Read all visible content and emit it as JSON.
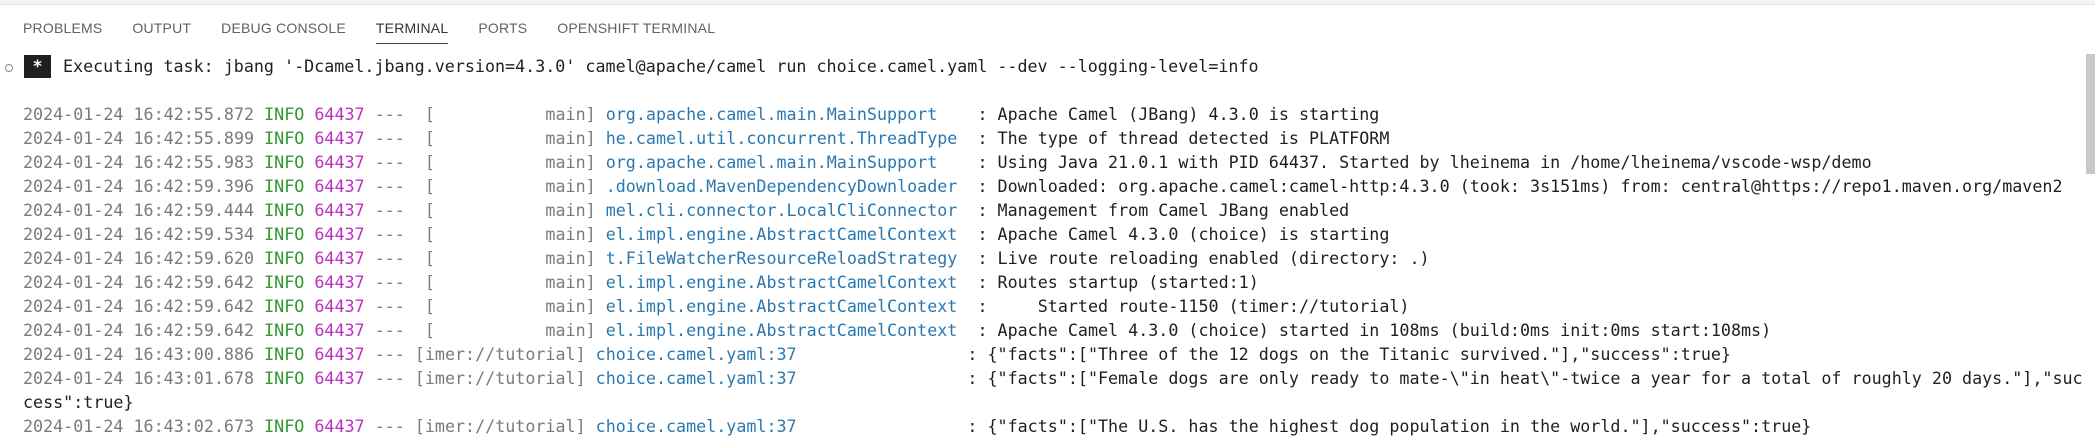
{
  "panel_tabs": [
    "PROBLEMS",
    "OUTPUT",
    "DEBUG CONSOLE",
    "TERMINAL",
    "PORTS",
    "OPENSHIFT TERMINAL"
  ],
  "active_tab": "TERMINAL",
  "task": {
    "badge": "*",
    "text": "Executing task: jbang '-Dcamel.jbang.version=4.3.0' camel@apache/camel run choice.camel.yaml --dev --logging-level=info"
  },
  "log_lines": [
    {
      "ts": "2024-01-24 16:42:55.872",
      "level": "INFO",
      "pid": "64437",
      "thread": "---  [           main]",
      "cls": "org.apache.camel.main.MainSupport   ",
      "msg": ": Apache Camel (JBang) 4.3.0 is starting"
    },
    {
      "ts": "2024-01-24 16:42:55.899",
      "level": "INFO",
      "pid": "64437",
      "thread": "---  [           main]",
      "cls": "he.camel.util.concurrent.ThreadType ",
      "msg": ": The type of thread detected is PLATFORM"
    },
    {
      "ts": "2024-01-24 16:42:55.983",
      "level": "INFO",
      "pid": "64437",
      "thread": "---  [           main]",
      "cls": "org.apache.camel.main.MainSupport   ",
      "msg": ": Using Java 21.0.1 with PID 64437. Started by lheinema in /home/lheinema/vscode-wsp/demo"
    },
    {
      "ts": "2024-01-24 16:42:59.396",
      "level": "INFO",
      "pid": "64437",
      "thread": "---  [           main]",
      "cls": ".download.MavenDependencyDownloader ",
      "msg": ": Downloaded: org.apache.camel:camel-http:4.3.0 (took: 3s151ms) from: central@https://repo1.maven.org/maven2"
    },
    {
      "ts": "2024-01-24 16:42:59.444",
      "level": "INFO",
      "pid": "64437",
      "thread": "---  [           main]",
      "cls": "mel.cli.connector.LocalCliConnector ",
      "msg": ": Management from Camel JBang enabled"
    },
    {
      "ts": "2024-01-24 16:42:59.534",
      "level": "INFO",
      "pid": "64437",
      "thread": "---  [           main]",
      "cls": "el.impl.engine.AbstractCamelContext ",
      "msg": ": Apache Camel 4.3.0 (choice) is starting"
    },
    {
      "ts": "2024-01-24 16:42:59.620",
      "level": "INFO",
      "pid": "64437",
      "thread": "---  [           main]",
      "cls": "t.FileWatcherResourceReloadStrategy ",
      "msg": ": Live route reloading enabled (directory: .)"
    },
    {
      "ts": "2024-01-24 16:42:59.642",
      "level": "INFO",
      "pid": "64437",
      "thread": "---  [           main]",
      "cls": "el.impl.engine.AbstractCamelContext ",
      "msg": ": Routes startup (started:1)"
    },
    {
      "ts": "2024-01-24 16:42:59.642",
      "level": "INFO",
      "pid": "64437",
      "thread": "---  [           main]",
      "cls": "el.impl.engine.AbstractCamelContext ",
      "msg": ":     Started route-1150 (timer://tutorial)"
    },
    {
      "ts": "2024-01-24 16:42:59.642",
      "level": "INFO",
      "pid": "64437",
      "thread": "---  [           main]",
      "cls": "el.impl.engine.AbstractCamelContext ",
      "msg": ": Apache Camel 4.3.0 (choice) started in 108ms (build:0ms init:0ms start:108ms)"
    },
    {
      "ts": "2024-01-24 16:43:00.886",
      "level": "INFO",
      "pid": "64437",
      "thread": "--- [imer://tutorial]",
      "cls": "choice.camel.yaml:37                ",
      "msg": ": {\"facts\":[\"Three of the 12 dogs on the Titanic survived.\"],\"success\":true}"
    },
    {
      "ts": "2024-01-24 16:43:01.678",
      "level": "INFO",
      "pid": "64437",
      "thread": "--- [imer://tutorial]",
      "cls": "choice.camel.yaml:37                ",
      "msg": ": {\"facts\":[\"Female dogs are only ready to mate-\\\"in heat\\\"-twice a year for a total of roughly 20 days.\"],\"suc"
    },
    {
      "ts": "",
      "level": "",
      "pid": "",
      "thread": "",
      "cls": "",
      "msg": "cess\":true}",
      "continuation": true
    },
    {
      "ts": "2024-01-24 16:43:02.673",
      "level": "INFO",
      "pid": "64437",
      "thread": "--- [imer://tutorial]",
      "cls": "choice.camel.yaml:37                ",
      "msg": ": {\"facts\":[\"The U.S. has the highest dog population in the world.\"],\"success\":true}"
    }
  ]
}
